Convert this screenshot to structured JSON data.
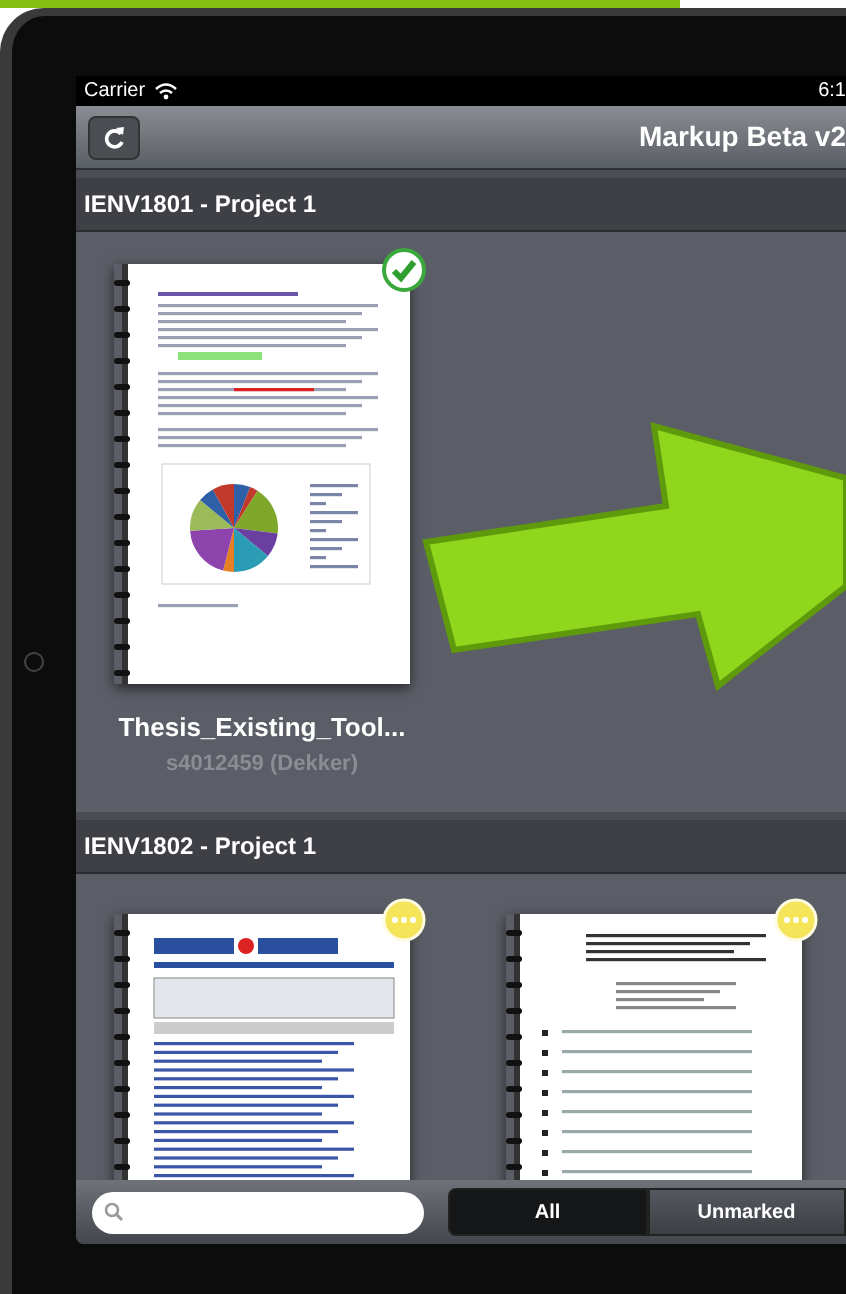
{
  "status_bar": {
    "carrier": "Carrier",
    "time": "6:1"
  },
  "nav_bar": {
    "title": "Markup Beta v2"
  },
  "sections": [
    {
      "title": "IENV1801 - Project 1",
      "documents": [
        {
          "kind": "report",
          "marked": true,
          "title": "Thesis_Existing_Tool...",
          "owner": "s4012459 (Dekker)"
        }
      ]
    },
    {
      "title": "IENV1802 - Project 1",
      "documents": [
        {
          "kind": "form",
          "marked": false
        },
        {
          "kind": "questionnaire",
          "marked": false
        }
      ]
    }
  ],
  "toolbar": {
    "segments": [
      {
        "label": "All",
        "selected": true
      },
      {
        "label": "Unmarked",
        "selected": false
      }
    ]
  }
}
